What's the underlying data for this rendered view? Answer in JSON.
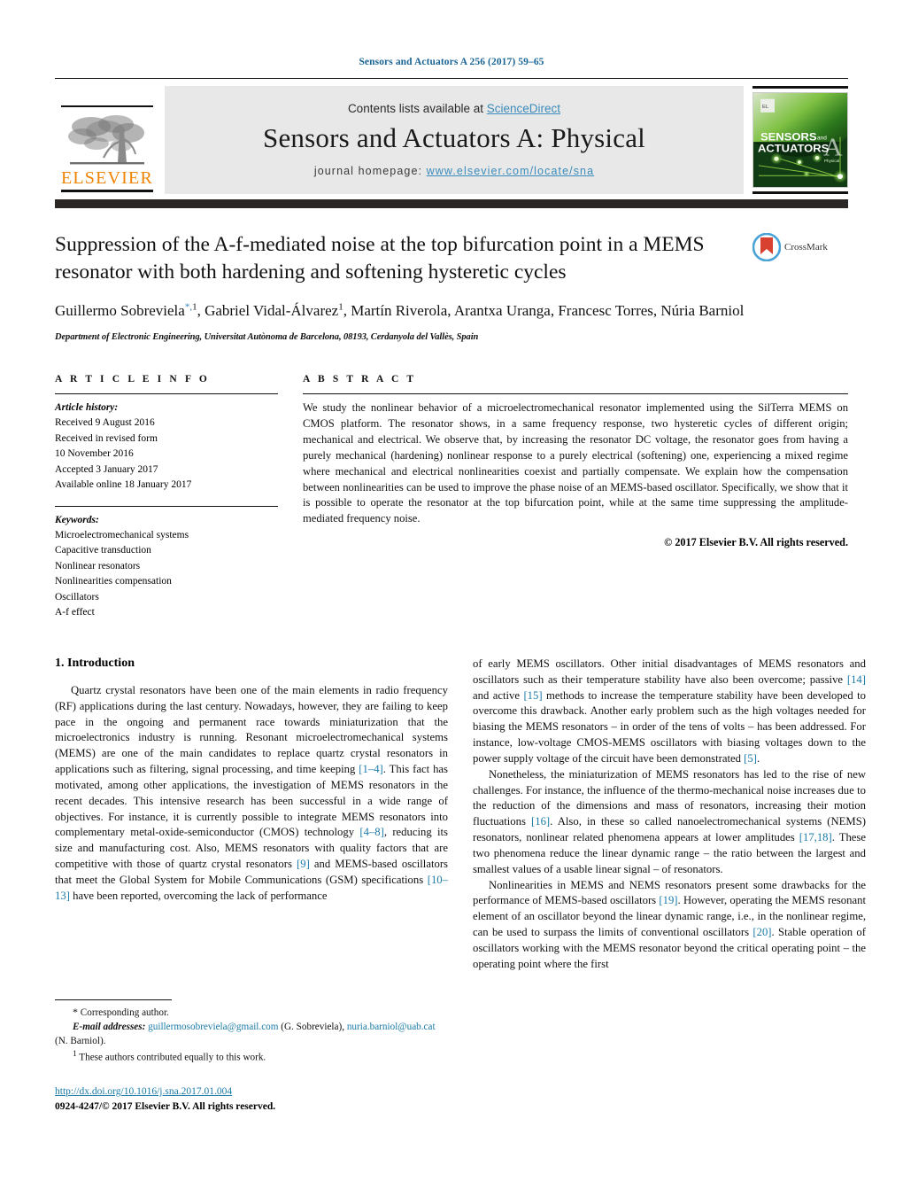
{
  "running_head": "Sensors and Actuators A 256 (2017) 59–65",
  "masthead": {
    "contents_prefix": "Contents lists available at ",
    "sciencedirect": "ScienceDirect",
    "journal_title": "Sensors and Actuators A: Physical",
    "homepage_prefix": "journal homepage: ",
    "homepage_url": "www.elsevier.com/locate/sna",
    "publisher_logo_text": "ELSEVIER",
    "cover_line1": "SENSORS",
    "cover_and": "and",
    "cover_line2": "ACTUATORS",
    "cover_letter": "A",
    "cover_sub": "Physical",
    "accent_orange": "#ef8200",
    "link_blue": "#3a8bbb",
    "band_gray": "#e8e8e8",
    "band_dark": "#2b2724"
  },
  "crossmark": {
    "label": "CrossMark"
  },
  "title": "Suppression of the A-f-mediated noise at the top bifurcation point in a MEMS resonator with both hardening and softening hysteretic cycles",
  "authors_html": "Guillermo Sobreviela<sup class=\"star\">*,</sup><sup>1</sup>, Gabriel Vidal-Álvarez<sup>1</sup>, Martín Riverola, Arantxa Uranga, Francesc Torres, Núria Barniol",
  "affiliation": "Department of Electronic Engineering, Universitat Autònoma de Barcelona, 08193, Cerdanyola del Vallès, Spain",
  "article_info": {
    "heading": "A R T I C L E   I N F O",
    "history_label": "Article history:",
    "history": [
      "Received 9 August 2016",
      "Received in revised form",
      "10 November 2016",
      "Accepted 3 January 2017",
      "Available online 18 January 2017"
    ],
    "keywords_label": "Keywords:",
    "keywords": [
      "Microelectromechanical systems",
      "Capacitive transduction",
      "Nonlinear resonators",
      "Nonlinearities compensation",
      "Oscillators",
      "A-f effect"
    ]
  },
  "abstract": {
    "heading": "A B S T R A C T",
    "text": "We study the nonlinear behavior of a microelectromechanical resonator implemented using the SilTerra MEMS on CMOS platform. The resonator shows, in a same frequency response, two hysteretic cycles of different origin; mechanical and electrical. We observe that, by increasing the resonator DC voltage, the resonator goes from having a purely mechanical (hardening) nonlinear response to a purely electrical (softening) one, experiencing a mixed regime where mechanical and electrical nonlinearities coexist and partially compensate. We explain how the compensation between nonlinearities can be used to improve the phase noise of an MEMS-based oscillator. Specifically, we show that it is possible to operate the resonator at the top bifurcation point, while at the same time suppressing the amplitude-mediated frequency noise.",
    "copyright": "© 2017 Elsevier B.V. All rights reserved."
  },
  "body": {
    "section_number_title": "1.  Introduction",
    "left_p1_html": "Quartz crystal resonators have been one of the main elements in radio frequency (RF) applications during the last century. Nowadays, however, they are failing to keep pace in the ongoing and permanent race towards miniaturization that the microelectronics industry is running. Resonant microelectromechanical systems (MEMS) are one of the main candidates to replace quartz crystal resonators in applications such as filtering, signal processing, and time keeping <span class=\"ref\">[1–4]</span>. This fact has motivated, among other applications, the investigation of MEMS resonators in the recent decades. This intensive research has been successful in a wide range of objectives. For instance, it is currently possible to integrate MEMS resonators into complementary metal-oxide-semiconductor (CMOS) technology <span class=\"ref\">[4–8]</span>, reducing its size and manufacturing cost. Also, MEMS resonators with quality factors that are competitive with those of quartz crystal resonators <span class=\"ref\">[9]</span> and MEMS-based oscillators that meet the Global System for Mobile Communications (GSM) specifications <span class=\"ref\">[10–13]</span> have been reported, overcoming the lack of performance",
    "right_p1_html": "of early MEMS oscillators. Other initial disadvantages of MEMS resonators and oscillators such as their temperature stability have also been overcome; passive <span class=\"ref\">[14]</span> and active <span class=\"ref\">[15]</span> methods to increase the temperature stability have been developed to overcome this drawback. Another early problem such as the high voltages needed for biasing the MEMS resonators – in order of the tens of volts – has been addressed. For instance, low-voltage CMOS-MEMS oscillators with biasing voltages down to the power supply voltage of the circuit have been demonstrated <span class=\"ref\">[5]</span>.",
    "right_p2_html": "Nonetheless, the miniaturization of MEMS resonators has led to the rise of new challenges. For instance, the influence of the thermo-mechanical noise increases due to the reduction of the dimensions and mass of resonators, increasing their motion fluctuations <span class=\"ref\">[16]</span>. Also, in these so called nanoelectromechanical systems (NEMS) resonators, nonlinear related phenomena appears at lower amplitudes <span class=\"ref\">[17,18]</span>. These two phenomena reduce the linear dynamic range – the ratio between the largest and smallest values of a usable linear signal – of resonators.",
    "right_p3_html": "Nonlinearities in MEMS and NEMS resonators present some drawbacks for the performance of MEMS-based oscillators <span class=\"ref\">[19]</span>. However, operating the MEMS resonant element of an oscillator beyond the linear dynamic range, i.e., in the nonlinear regime, can be used to surpass the limits of conventional oscillators <span class=\"ref\">[20]</span>. Stable operation of oscillators working with the MEMS resonator beyond the critical operating point – the operating point where the first"
  },
  "footnotes": {
    "corresponding_html": "<span style=\"font-size:12px\">*</span>  Corresponding author.",
    "emails_html": "<span class=\"ital\">E-mail addresses:</span> <span class=\"link\">guillermosobreviela@gmail.com</span> (G. Sobreviela), <span class=\"link\">nuria.barniol@uab.cat</span> (N. Barniol).",
    "equal_contrib_html": "<sup>1</sup>  These authors contributed equally to this work."
  },
  "doi_block": {
    "doi_url": "http://dx.doi.org/10.1016/j.sna.2017.01.004",
    "issn_line": "0924-4247/© 2017 Elsevier B.V. All rights reserved."
  }
}
